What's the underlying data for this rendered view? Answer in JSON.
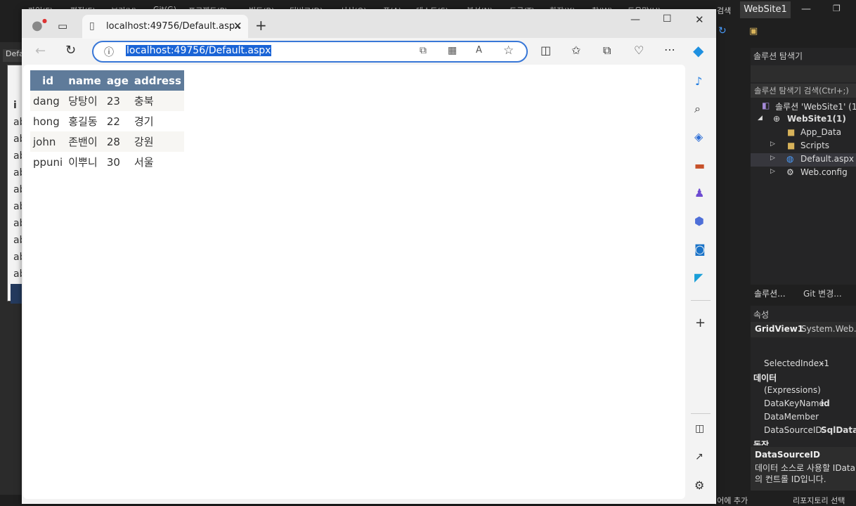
{
  "vs": {
    "menu": [
      "파일(F)",
      "편집(E)",
      "보기(V)",
      "Git(G)",
      "프로젝트(P)",
      "빌드(B)",
      "디버그(D)",
      "서식(O)",
      "표(A)",
      "테스트(S)",
      "분석(N)",
      "도구(T)",
      "확장(X)",
      "창(W)",
      "도움말(H)",
      "검색"
    ],
    "title": "WebSite1",
    "left_tab": "Defa",
    "left_rows": [
      "i",
      "ab",
      "ab",
      "ab",
      "ab",
      "ab",
      "ab",
      "ab",
      "ab",
      "ab",
      "ab"
    ],
    "solution": {
      "title": "솔루션 탐색기",
      "search": "솔루션 탐색기 검색(Ctrl+;)",
      "items": [
        {
          "label": "솔루션 'WebSite1' (1"
        },
        {
          "label": "WebSite1(1)"
        },
        {
          "label": "App_Data"
        },
        {
          "label": "Scripts"
        },
        {
          "label": "Default.aspx"
        },
        {
          "label": "Web.config"
        }
      ],
      "tabs": [
        "솔루션...",
        "Git 변경..."
      ]
    },
    "properties": {
      "title": "속성",
      "object": "GridView1",
      "object_type": "System.Web.U",
      "rows": [
        {
          "name": "SelectedIndex",
          "value": "-1"
        },
        {
          "category": "데이터"
        },
        {
          "name": "(Expressions)",
          "value": ""
        },
        {
          "name": "DataKeyName",
          "value": "id"
        },
        {
          "name": "DataMember",
          "value": ""
        },
        {
          "name": "DataSourceID",
          "value": "SqlDataS"
        },
        {
          "category": "동작"
        }
      ],
      "desc_title": "DataSourceID",
      "desc_text1": "데이터 소스로 사용할 IData",
      "desc_text2": "의 컨트롤 ID입니다."
    },
    "status": {
      "add": "제어에 추가",
      "repo": "리포지토리 선택"
    }
  },
  "browser": {
    "tab_title": "localhost:49756/Default.aspx",
    "url": "localhost:49756/Default.aspx",
    "reload_label": "C"
  },
  "grid": {
    "columns": [
      "id",
      "name",
      "age",
      "address"
    ],
    "rows": [
      [
        "dang",
        "당탕이",
        "23",
        "충북"
      ],
      [
        "hong",
        "홍길동",
        "22",
        "경기"
      ],
      [
        "john",
        "존밴이",
        "28",
        "강원"
      ],
      [
        "ppuni",
        "이뿌니",
        "30",
        "서울"
      ]
    ]
  }
}
